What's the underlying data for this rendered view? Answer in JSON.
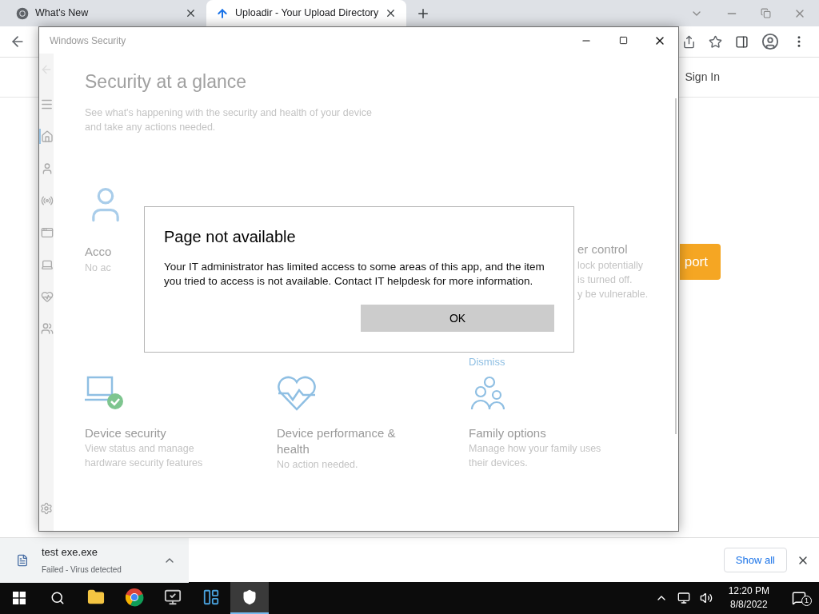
{
  "browser": {
    "tabs": [
      {
        "title": "What's New",
        "kind": "chrome",
        "selected": false
      },
      {
        "title": "Uploadir - Your Upload Directory",
        "kind": "upload",
        "selected": true
      }
    ],
    "page": {
      "sign_in": "Sign In",
      "orange_button": "port"
    }
  },
  "security_window": {
    "title": "Windows Security",
    "nav": [
      {
        "kind": "home",
        "selected": true
      },
      {
        "kind": "account",
        "selected": false
      },
      {
        "kind": "network",
        "selected": false
      },
      {
        "kind": "app",
        "selected": false
      },
      {
        "kind": "device",
        "selected": false
      },
      {
        "kind": "health",
        "selected": false
      },
      {
        "kind": "family",
        "selected": false
      }
    ],
    "heading": "Security at a glance",
    "subtitle": "See what's happening with the security and health of your device and take any actions needed.",
    "top_cards": [
      {
        "title": "Acco",
        "lines": [
          "No ac"
        ]
      },
      {
        "title": "er control",
        "lines": [
          "lock potentially",
          "is turned off.",
          "y be vulnerable."
        ],
        "link": "Dismiss"
      }
    ],
    "bottom_cards": [
      {
        "kind": "device",
        "title": "Device security",
        "text": "View status and manage hardware security features"
      },
      {
        "kind": "health",
        "title": "Device performance & health",
        "text": "No action needed."
      },
      {
        "kind": "family",
        "title": "Family options",
        "text": "Manage how your family uses their devices."
      }
    ]
  },
  "dialog": {
    "title": "Page not available",
    "message": "Your IT administrator has limited access to some areas of this app, and the item you tried to access is not available. Contact IT helpdesk for more information.",
    "button": "OK"
  },
  "downloads": {
    "file": "test exe.exe",
    "status": "Failed - Virus detected",
    "show_all": "Show all"
  },
  "taskbar": {
    "apps": [
      {
        "kind": "explorer",
        "selected": false
      },
      {
        "kind": "chrome",
        "selected": false
      },
      {
        "kind": "monitor",
        "selected": false
      },
      {
        "kind": "control",
        "selected": false
      },
      {
        "kind": "security",
        "selected": true
      }
    ],
    "time": "12:20 PM",
    "date": "8/8/2022",
    "notifications": "1"
  }
}
